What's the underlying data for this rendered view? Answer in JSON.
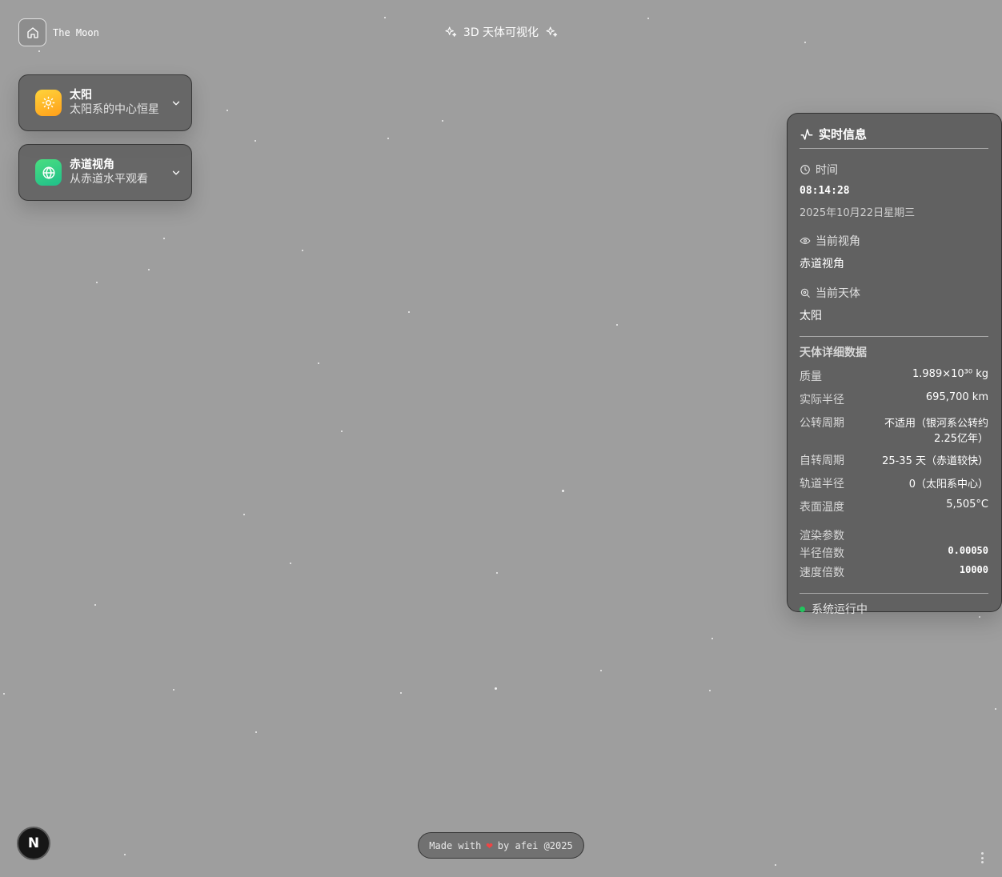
{
  "home": {
    "label": "The Moon",
    "icon": "home-icon"
  },
  "header": {
    "title": "3D 天体可视化",
    "icon": "sparkles-icon"
  },
  "body_selector": {
    "icon": "sun-icon",
    "title": "太阳",
    "subtitle": "太阳系的中心恒星"
  },
  "view_selector": {
    "icon": "globe-icon",
    "title": "赤道视角",
    "subtitle": "从赤道水平观看"
  },
  "info_panel": {
    "title": "实时信息",
    "icon": "activity-icon",
    "time_label": "时间",
    "time_value": "08:14:28",
    "date_value": "2025年10月22日星期三",
    "view_label": "当前视角",
    "view_value": "赤道视角",
    "body_label": "当前天体",
    "body_value": "太阳",
    "details_title": "天体详细数据",
    "details": [
      {
        "key": "质量",
        "value": "1.989×10³⁰ kg"
      },
      {
        "key": "实际半径",
        "value": "695,700 km"
      },
      {
        "key": "公转周期",
        "value": "不适用（银河系公转约 2.25亿年）"
      },
      {
        "key": "自转周期",
        "value": "25-35 天（赤道较快）"
      },
      {
        "key": "轨道半径",
        "value": "0（太阳系中心）"
      },
      {
        "key": "表面温度",
        "value": "5,505°C"
      }
    ],
    "render_title": "渲染参数",
    "render": [
      {
        "key": "半径倍数",
        "value": "0.00050"
      },
      {
        "key": "速度倍数",
        "value": "10000"
      }
    ],
    "status": "系统运行中",
    "status_color": "#22c55e"
  },
  "footer": {
    "made_with": "Made with",
    "by": "by afei @2025",
    "heart_color": "#ef4444"
  },
  "badge": {
    "letter": "N"
  },
  "colors": {
    "background": "#9e9e9e",
    "sun_gradient": "#ffb020",
    "globe_gradient": "#34d399"
  }
}
